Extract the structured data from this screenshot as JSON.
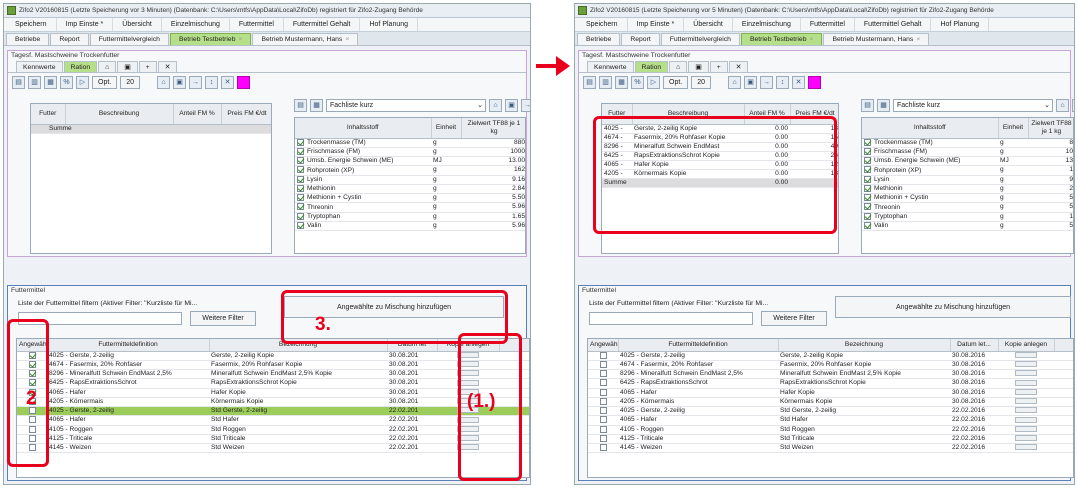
{
  "left": {
    "title": "Zifo2 V20160815 (Letzte Speicherung vor 3 Minuten) (Datenbank: C:\\Users\\mtfs\\AppData\\Local\\ZifoDb) registriert für Zifo2-Zugang Behörde",
    "menu": [
      "Speichern",
      "Imp Einste *",
      "Übersicht",
      "Einzelmischung",
      "Futtermittel",
      "Futtermittel Gehalt",
      "Hof Planung"
    ],
    "tabs": [
      {
        "label": "Betriebe",
        "active": false,
        "closable": false
      },
      {
        "label": "Report",
        "active": false,
        "closable": false
      },
      {
        "label": "Futtermittelvergleich",
        "active": false,
        "closable": false
      },
      {
        "label": "Betrieb Testbetrieb",
        "active": true,
        "closable": true
      },
      {
        "label": "Betrieb Mustermann, Hans",
        "active": false,
        "closable": true
      }
    ],
    "group_title": "Tagesf. Mastschweine Trockenfutter",
    "subtabs": [
      {
        "label": "Kennwerte",
        "active": false
      },
      {
        "label": "Ration",
        "active": true
      },
      {
        "label": "⌂",
        "active": false
      },
      {
        "label": "▣",
        "active": false
      },
      {
        "label": "+",
        "active": false
      },
      {
        "label": "✕",
        "active": false
      }
    ],
    "toolbar": {
      "opt": "Opt.",
      "twenty": "20"
    },
    "ration_headers": [
      "Futter",
      "Beschreibung",
      "Anteil FM %",
      "Preis FM €/dt"
    ],
    "ration_rows": [
      {
        "futter": "Summe",
        "beschreibung": "",
        "anteil": "",
        "preis": ""
      }
    ],
    "nutrient_filter": "Fachliste kurz",
    "nutrient_headers": [
      "Inhaltsstoff",
      "Einheit",
      "Zielwert TF88 je 1 kg"
    ],
    "nutrients": [
      {
        "name": "Trockenmasse (TM)",
        "unit": "g",
        "value": "880"
      },
      {
        "name": "Frischmasse (FM)",
        "unit": "g",
        "value": "1000"
      },
      {
        "name": "Umsb. Energie Schwein (ME)",
        "unit": "MJ",
        "value": "13.00"
      },
      {
        "name": "Rohprotein (XP)",
        "unit": "g",
        "value": "162"
      },
      {
        "name": "Lysin",
        "unit": "g",
        "value": "9.16"
      },
      {
        "name": "Methionin",
        "unit": "g",
        "value": "2.84"
      },
      {
        "name": "Methionin + Cystin",
        "unit": "g",
        "value": "5.50"
      },
      {
        "name": "Threonin",
        "unit": "g",
        "value": "5.96"
      },
      {
        "name": "Tryptophan",
        "unit": "g",
        "value": "1.65"
      },
      {
        "name": "Valin",
        "unit": "g",
        "value": "5.96"
      }
    ],
    "fm_title": "Futtermittel",
    "filter_label": "Liste der Futtermittel filtern (Aktiver Filter: \"Kurzliste für Mi...",
    "weitere_filter": "Weitere Filter",
    "add_button": "Angewählte zu Mischung hinzufügen",
    "fm_headers": [
      "Angewählt",
      "Futtermitteldefinition",
      "Bezeichnung",
      "Datum let",
      "Kopie anlegen"
    ],
    "fm_rows": [
      {
        "checked": true,
        "def": "4025 - Gerste, 2-zeilig",
        "bez": "Gerste, 2-zeilig Kopie",
        "datum": "30.08.201",
        "sel": false
      },
      {
        "checked": true,
        "def": "4674 - Fasermix, 20% Rohfaser",
        "bez": "Fasermix, 20% Rohfaser Kopie",
        "datum": "30.08.201",
        "sel": false
      },
      {
        "checked": true,
        "def": "8296 - Mineralfutt Schwein EndMast 2,5%",
        "bez": "Mineralfutt Schwein EndMast 2,5% Kopie",
        "datum": "30.08.201",
        "sel": false
      },
      {
        "checked": true,
        "def": "6425 - RapsExtraktionsSchrot",
        "bez": "RapsExtraktionsSchrot Kopie",
        "datum": "30.08.201",
        "sel": false
      },
      {
        "checked": true,
        "def": "4065 - Hafer",
        "bez": "Hafer Kopie",
        "datum": "30.08.201",
        "sel": false
      },
      {
        "checked": true,
        "def": "4205 - Körnermais",
        "bez": "Körnermais Kopie",
        "datum": "30.08.201",
        "sel": false
      },
      {
        "checked": false,
        "def": "4025 - Gerste, 2-zeilig",
        "bez": "Std Gerste, 2-zeilig",
        "datum": "22.02.201",
        "sel": true
      },
      {
        "checked": false,
        "def": "4065 - Hafer",
        "bez": "Std Hafer",
        "datum": "22.02.201",
        "sel": false
      },
      {
        "checked": false,
        "def": "4105 - Roggen",
        "bez": "Std Roggen",
        "datum": "22.02.201",
        "sel": false
      },
      {
        "checked": false,
        "def": "4125 - Triticale",
        "bez": "Std Triticale",
        "datum": "22.02.201",
        "sel": false
      },
      {
        "checked": false,
        "def": "4145 - Weizen",
        "bez": "Std Weizen",
        "datum": "22.02.201",
        "sel": false
      }
    ],
    "annotations": {
      "a1": "(1.)",
      "a2": "2",
      "a3": "3."
    }
  },
  "right": {
    "title": "Zifo2 V20160815 (Letzte Speicherung vor 5 Minuten) (Datenbank: C:\\Users\\mtfs\\AppData\\Local\\ZifoDb) registriert für Zifo2-Zugang Behörde",
    "menu": [
      "Speichern",
      "Imp Einste *",
      "Übersicht",
      "Einzelmischung",
      "Futtermittel",
      "Futtermittel Gehalt",
      "Hof Planung"
    ],
    "tabs": [
      {
        "label": "Betriebe",
        "active": false,
        "closable": false
      },
      {
        "label": "Report",
        "active": false,
        "closable": false
      },
      {
        "label": "Futtermittelvergleich",
        "active": false,
        "closable": false
      },
      {
        "label": "Betrieb Testbetrieb",
        "active": true,
        "closable": true
      },
      {
        "label": "Betrieb Mustermann, Hans",
        "active": false,
        "closable": true
      }
    ],
    "group_title": "Tagesf. Mastschweine Trockenfutter",
    "subtabs": [
      {
        "label": "Kennwerte",
        "active": false
      },
      {
        "label": "Ration",
        "active": true
      },
      {
        "label": "⌂",
        "active": false
      },
      {
        "label": "▣",
        "active": false
      },
      {
        "label": "+",
        "active": false
      },
      {
        "label": "✕",
        "active": false
      }
    ],
    "toolbar": {
      "opt": "Opt.",
      "twenty": "20"
    },
    "ration_headers": [
      "Futter",
      "Beschreibung",
      "Anteil FM %",
      "Preis FM €/dt"
    ],
    "ration_rows": [
      {
        "futter": "4025 -",
        "beschreibung": "Gerste, 2-zeilig Kopie",
        "anteil": "0.00",
        "preis": "13"
      },
      {
        "futter": "4674 -",
        "beschreibung": "Fasermix, 20% Rohfaser Kopie",
        "anteil": "0.00",
        "preis": "15"
      },
      {
        "futter": "8296 -",
        "beschreibung": "Mineralfutt Schwein EndMast",
        "anteil": "0.00",
        "preis": "49"
      },
      {
        "futter": "6425 -",
        "beschreibung": "RapsExtraktionsSchrot Kopie",
        "anteil": "0.00",
        "preis": "26"
      },
      {
        "futter": "4065 -",
        "beschreibung": "Hafer Kopie",
        "anteil": "0.00",
        "preis": "12"
      },
      {
        "futter": "4205 -",
        "beschreibung": "Körnermais Kopie",
        "anteil": "0.00",
        "preis": "13"
      },
      {
        "futter": "Summe",
        "beschreibung": "",
        "anteil": "0.00",
        "preis": ""
      }
    ],
    "nutrient_filter": "Fachliste kurz",
    "nutrient_headers": [
      "Inhaltsstoff",
      "Einheit",
      "Zielwert TF88 je 1 kg"
    ],
    "nutrients": [
      {
        "name": "Trockenmasse (TM)",
        "unit": "g",
        "value": "8"
      },
      {
        "name": "Frischmasse (FM)",
        "unit": "g",
        "value": "10"
      },
      {
        "name": "Umsb. Energie Schwein (ME)",
        "unit": "MJ",
        "value": "13"
      },
      {
        "name": "Rohprotein (XP)",
        "unit": "g",
        "value": "1"
      },
      {
        "name": "Lysin",
        "unit": "g",
        "value": "9"
      },
      {
        "name": "Methionin",
        "unit": "g",
        "value": "2"
      },
      {
        "name": "Methionin + Cystin",
        "unit": "g",
        "value": "5"
      },
      {
        "name": "Threonin",
        "unit": "g",
        "value": "5"
      },
      {
        "name": "Tryptophan",
        "unit": "g",
        "value": "1"
      },
      {
        "name": "Valin",
        "unit": "g",
        "value": "5"
      }
    ],
    "fm_title": "Futtermittel",
    "filter_label": "Liste der Futtermittel filtern (Aktiver Filter: \"Kurzliste für Mi...",
    "weitere_filter": "Weitere Filter",
    "add_button": "Angewählte zu Mischung hinzufügen",
    "fm_headers": [
      "Angewählt",
      "Futtermitteldefinition",
      "Bezeichnung",
      "Datum let...",
      "Kopie anlegen"
    ],
    "fm_rows": [
      {
        "checked": false,
        "def": "4025 - Gerste, 2-zeilig",
        "bez": "Gerste, 2-zeilig Kopie",
        "datum": "30.08.2016",
        "sel": false
      },
      {
        "checked": false,
        "def": "4674 - Fasermix, 20% Rohfaser",
        "bez": "Fasermix, 20% Rohfaser Kopie",
        "datum": "30.08.2016",
        "sel": false
      },
      {
        "checked": false,
        "def": "8296 - Mineralfutt Schwein EndMast 2,5%",
        "bez": "Mineralfutt Schwein EndMast 2,5% Kopie",
        "datum": "30.08.2016",
        "sel": false
      },
      {
        "checked": false,
        "def": "6425 - RapsExtraktionsSchrot",
        "bez": "RapsExtraktionsSchrot Kopie",
        "datum": "30.08.2016",
        "sel": false
      },
      {
        "checked": false,
        "def": "4065 - Hafer",
        "bez": "Hafer Kopie",
        "datum": "30.08.2016",
        "sel": false
      },
      {
        "checked": false,
        "def": "4205 - Körnermais",
        "bez": "Körnermais Kopie",
        "datum": "30.08.2016",
        "sel": false
      },
      {
        "checked": false,
        "def": "4025 - Gerste, 2-zeilig",
        "bez": "Std Gerste, 2-zeilig",
        "datum": "22.02.2016",
        "sel": false
      },
      {
        "checked": false,
        "def": "4065 - Hafer",
        "bez": "Std Hafer",
        "datum": "22.02.2016",
        "sel": false
      },
      {
        "checked": false,
        "def": "4105 - Roggen",
        "bez": "Std Roggen",
        "datum": "22.02.2016",
        "sel": false
      },
      {
        "checked": false,
        "def": "4125 - Triticale",
        "bez": "Std Triticale",
        "datum": "22.02.2016",
        "sel": false
      },
      {
        "checked": false,
        "def": "4145 - Weizen",
        "bez": "Std Weizen",
        "datum": "22.02.2016",
        "sel": false
      }
    ]
  },
  "colors": {
    "annotation_red": "#e8001c",
    "active_tab_green": "#b6df8a",
    "selected_row_green": "#9ccc5a",
    "magenta_swatch": "#ff00ff"
  },
  "icons": [
    "app-icon",
    "document-icon",
    "chart-icon",
    "percent-icon",
    "export-icon",
    "print-icon",
    "save-icon",
    "checkbox-icon",
    "right-arrow-icon"
  ]
}
